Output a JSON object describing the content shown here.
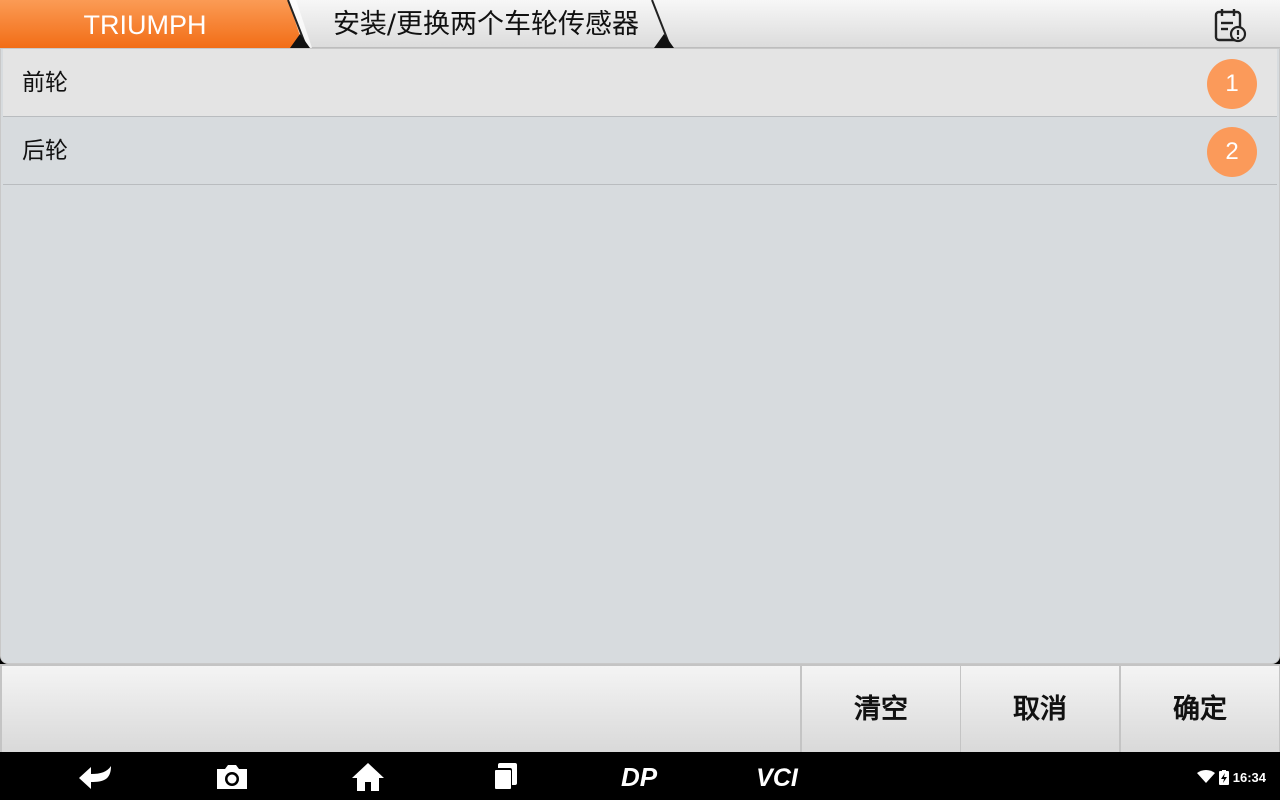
{
  "header": {
    "brand": "TRIUMPH",
    "page_title": "安装/更换两个车轮传感器",
    "brand_color": "#f57a24",
    "report_icon": "report-calendar-icon"
  },
  "list": {
    "items": [
      {
        "label": "前轮",
        "badge": "1"
      },
      {
        "label": "后轮",
        "badge": "2"
      }
    ],
    "badge_color": "#fb9a5a"
  },
  "toolbar": {
    "clear_label": "清空",
    "cancel_label": "取消",
    "ok_label": "确定"
  },
  "navbar": {
    "icons": [
      "back-icon",
      "camera-icon",
      "home-icon",
      "recent-apps-icon",
      "dp-icon",
      "vci-icon"
    ],
    "dp_text": "DP",
    "vci_text": "VCI",
    "time": "16:34"
  }
}
